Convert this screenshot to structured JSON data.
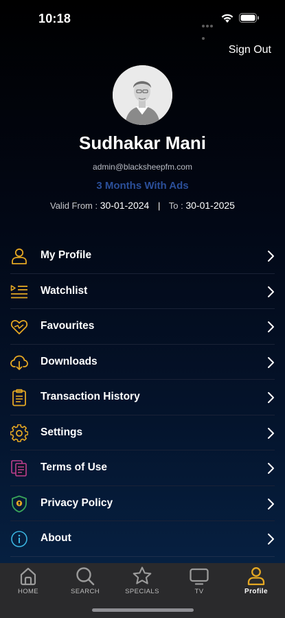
{
  "status_bar": {
    "time": "10:18"
  },
  "header": {
    "sign_out_label": "Sign Out"
  },
  "profile": {
    "name": "Sudhakar Mani",
    "email": "admin@blacksheepfm.com",
    "plan": "3 Months With Ads",
    "valid_from_label": "Valid From :",
    "valid_from": "30-01-2024",
    "separator": "|",
    "valid_to_label": "To :",
    "valid_to": "30-01-2025"
  },
  "menu": {
    "items": [
      {
        "label": "My Profile",
        "icon": "user-icon"
      },
      {
        "label": "Watchlist",
        "icon": "watchlist-icon"
      },
      {
        "label": "Favourites",
        "icon": "heart-icon"
      },
      {
        "label": "Downloads",
        "icon": "cloud-download-icon"
      },
      {
        "label": "Transaction History",
        "icon": "clipboard-icon"
      },
      {
        "label": "Settings",
        "icon": "gear-icon"
      },
      {
        "label": "Terms of Use",
        "icon": "documents-icon"
      },
      {
        "label": "Privacy Policy",
        "icon": "shield-icon"
      },
      {
        "label": "About",
        "icon": "info-icon"
      }
    ]
  },
  "tabs": [
    {
      "label": "HOME",
      "icon": "home-icon",
      "active": false
    },
    {
      "label": "SEARCH",
      "icon": "search-icon",
      "active": false
    },
    {
      "label": "SPECIALS",
      "icon": "star-icon",
      "active": false
    },
    {
      "label": "TV",
      "icon": "tv-icon",
      "active": false
    },
    {
      "label": "Profile",
      "icon": "user-icon",
      "active": true
    }
  ],
  "colors": {
    "accent_icon": "#e5a823",
    "plan_text": "#2b4f9a",
    "tab_bar": "#2a2a2c"
  }
}
